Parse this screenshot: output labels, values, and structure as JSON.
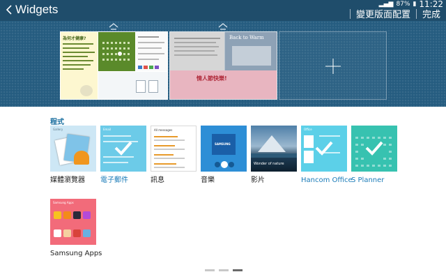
{
  "topbar": {
    "title": "Widgets",
    "actions": [
      "變更版面配置",
      "完成"
    ],
    "status": {
      "battery": "87%",
      "time": "11:22"
    }
  },
  "home_screen": {
    "note_widget_text": "為何才健康?",
    "video_widget_text": "Back to Warm",
    "flowers_widget_text": "情人節快樂!"
  },
  "widgets": {
    "section_title": "程式",
    "items": [
      {
        "label": "媒體瀏覽器",
        "added": false,
        "caption": "Gallery"
      },
      {
        "label": "電子郵件",
        "added": true,
        "caption": "Email"
      },
      {
        "label": "訊息",
        "added": false,
        "caption": "All messages"
      },
      {
        "label": "音樂",
        "added": false,
        "caption": "SAMSUNG"
      },
      {
        "label": "影片",
        "added": false,
        "caption": "Wonder of nature"
      },
      {
        "label": "Hancom Office",
        "added": true,
        "caption": "Office"
      },
      {
        "label": "S Planner",
        "added": true,
        "caption": ""
      },
      {
        "label": "Samsung Apps",
        "added": false,
        "caption": "Samsung Apps"
      }
    ]
  },
  "colors": {
    "topbar": "#1f4d6b",
    "panel": "#255c80",
    "accent": "#1a7bb8"
  },
  "pager": {
    "pages": 3,
    "active": 3
  }
}
